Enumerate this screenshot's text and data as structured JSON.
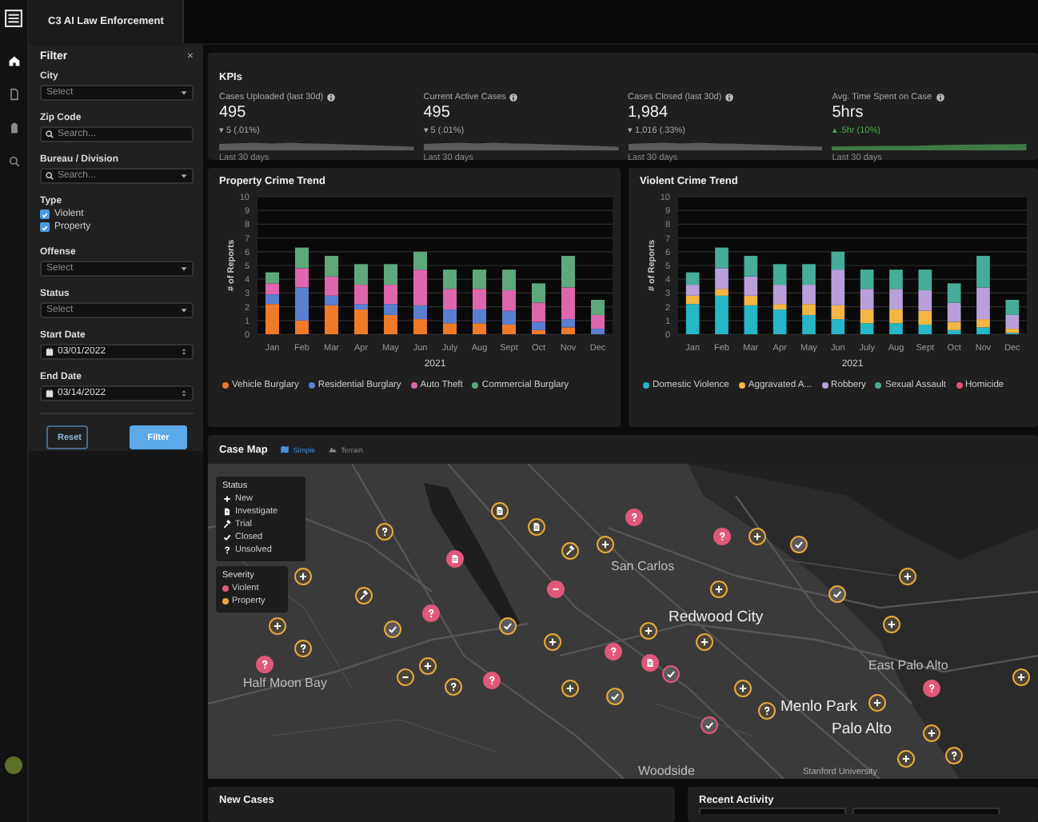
{
  "rail": [
    {
      "selected": true
    },
    {
      "selected": false
    },
    {
      "selected": false
    },
    {
      "selected": false
    }
  ],
  "app_tab": {
    "title": "C3 AI Law Enforcement"
  },
  "filter": {
    "title": "Filter",
    "close": "×",
    "fields": [
      {
        "kind": "select",
        "label": "City",
        "placeholder": "Select"
      },
      {
        "kind": "search",
        "label": "Zip Code",
        "placeholder": "Search..."
      },
      {
        "kind": "search_select",
        "label": "Bureau / Division",
        "placeholder": "Search..."
      },
      {
        "kind": "checkboxes",
        "label": "Type",
        "options": [
          {
            "label": "Violent",
            "checked": true
          },
          {
            "label": "Property",
            "checked": true
          }
        ]
      },
      {
        "kind": "select",
        "label": "Offense",
        "placeholder": "Select"
      },
      {
        "kind": "select",
        "label": "Status",
        "placeholder": "Select"
      },
      {
        "kind": "date",
        "label": "Start Date",
        "value": "03/01/2022"
      },
      {
        "kind": "date",
        "label": "End Date",
        "value": "03/14/2022"
      }
    ],
    "buttons": [
      {
        "label": "Reset",
        "kind": "secondary"
      },
      {
        "label": "Filter",
        "kind": "primary"
      }
    ]
  },
  "kpis": {
    "title": "KPIs",
    "items": [
      {
        "label": "Cases Uploaded (last 30d)",
        "value": "495",
        "change": "▾ 5 (.01%)",
        "positive": false,
        "footer": "Last 30 days"
      },
      {
        "label": "Current Active Cases",
        "value": "495",
        "change": "▾ 5 (.01%)",
        "positive": false,
        "footer": "Last 30 days"
      },
      {
        "label": "Cases Closed (last 30d)",
        "value": "1,984",
        "change": "▾ 1,016 (.33%)",
        "positive": false,
        "footer": "Last 30 days"
      },
      {
        "label": "Avg. Time Spent on Case",
        "value": "5hrs",
        "change": "▴ .5hr (10%)",
        "positive": true,
        "footer": "Last 30 days"
      }
    ]
  },
  "charts": [
    {
      "title": "Property Crime Trend",
      "chart_data": {
        "type": "bar",
        "stacked": true,
        "grid": true,
        "xlabel": "2021",
        "ylabel": "# of Reports",
        "categories": [
          "Jan",
          "Feb",
          "Mar",
          "Apr",
          "May",
          "Jun",
          "July",
          "Aug",
          "Sept",
          "Oct",
          "Nov",
          "Dec"
        ],
        "ylim": [
          0,
          10
        ],
        "yticks": [
          0,
          1,
          2,
          3,
          4,
          5,
          6,
          7,
          8,
          9,
          10
        ],
        "series": [
          {
            "name": "Vehicle Burglary",
            "color": "#f07a2a",
            "values": [
              2.2,
              1.0,
              2.1,
              1.8,
              1.4,
              1.1,
              0.8,
              0.8,
              0.7,
              0.3,
              0.5,
              0
            ]
          },
          {
            "name": "Residential Burglary",
            "color": "#5a7fd0",
            "values": [
              0.7,
              2.4,
              0.7,
              0.4,
              0.8,
              1.0,
              1.0,
              1.0,
              1.0,
              0.6,
              0.6,
              0.4
            ]
          },
          {
            "name": "Auto Theft",
            "color": "#de66ad",
            "values": [
              0.8,
              1.4,
              1.4,
              1.4,
              1.4,
              2.6,
              1.5,
              1.5,
              1.5,
              1.4,
              2.3,
              1.0
            ]
          },
          {
            "name": "Commercial Burglary",
            "color": "#5fa87e",
            "values": [
              0.8,
              1.5,
              1.5,
              1.5,
              1.5,
              1.3,
              1.4,
              1.4,
              1.5,
              1.4,
              2.3,
              1.1
            ]
          }
        ]
      }
    },
    {
      "title": "Violent Crime Trend",
      "chart_data": {
        "type": "bar",
        "stacked": true,
        "grid": true,
        "xlabel": "2021",
        "ylabel": "# of Reports",
        "categories": [
          "Jan",
          "Feb",
          "Mar",
          "Apr",
          "May",
          "Jun",
          "July",
          "Aug",
          "Sept",
          "Oct",
          "Nov",
          "Dec"
        ],
        "ylim": [
          0,
          10
        ],
        "yticks": [
          0,
          1,
          2,
          3,
          4,
          5,
          6,
          7,
          8,
          9,
          10
        ],
        "series": [
          {
            "name": "Domestic Violence",
            "color": "#27b6c6",
            "values": [
              2.2,
              2.8,
              2.1,
              1.8,
              1.4,
              1.1,
              0.8,
              0.8,
              0.7,
              0.3,
              0.5,
              0.1
            ]
          },
          {
            "name": "Aggravated A...",
            "color": "#f2b645",
            "values": [
              0.6,
              0.5,
              0.7,
              0.4,
              0.8,
              1.0,
              1.0,
              1.0,
              1.0,
              0.6,
              0.6,
              0.3
            ]
          },
          {
            "name": "Robbery",
            "color": "#b9a0da",
            "values": [
              0.8,
              1.5,
              1.4,
              1.4,
              1.4,
              2.6,
              1.5,
              1.5,
              1.5,
              1.4,
              2.3,
              1.0
            ]
          },
          {
            "name": "Sexual Assault",
            "color": "#45ad98",
            "values": [
              0.9,
              1.5,
              1.5,
              1.5,
              1.5,
              1.3,
              1.4,
              1.4,
              1.5,
              1.4,
              2.3,
              1.1
            ]
          },
          {
            "name": "Homicide",
            "color": "#e4506e",
            "values": [
              0,
              0,
              0,
              0,
              0,
              0,
              0,
              0,
              0,
              0,
              0,
              0
            ]
          }
        ]
      }
    }
  ],
  "case_map": {
    "title": "Case Map",
    "views": [
      {
        "label": "Simple",
        "selected": true
      },
      {
        "label": "Terrain",
        "selected": false
      }
    ],
    "status_legend": {
      "title": "Status",
      "items": [
        {
          "kind": "new",
          "label": "New"
        },
        {
          "kind": "investigate",
          "label": "Investigate"
        },
        {
          "kind": "trial",
          "label": "Trial"
        },
        {
          "kind": "closed",
          "label": "Closed"
        },
        {
          "kind": "unsolved",
          "label": "Unsolved"
        }
      ]
    },
    "severity_legend": {
      "title": "Severity",
      "items": [
        {
          "label": "Violent",
          "color": "#e0587a"
        },
        {
          "label": "Property",
          "color": "#e5a93c"
        }
      ]
    },
    "places": [
      {
        "name": "Half Moon Bay",
        "kind": "town"
      },
      {
        "name": "San Carlos",
        "kind": "town"
      },
      {
        "name": "Redwood City",
        "kind": "city"
      },
      {
        "name": "East Palo Alto",
        "kind": "town"
      },
      {
        "name": "Menlo Park",
        "kind": "city"
      },
      {
        "name": "Palo Alto",
        "kind": "city"
      },
      {
        "name": "Woodside",
        "kind": "town"
      },
      {
        "name": "Stanford University",
        "kind": "landmark"
      }
    ],
    "pins": [
      {
        "kind": "unsolved",
        "violent": false
      },
      {
        "kind": "investigate",
        "violent": false
      },
      {
        "kind": "investigate",
        "violent": false
      },
      {
        "kind": "trial",
        "violent": false
      },
      {
        "kind": "investigate",
        "violent": true
      },
      {
        "kind": "unsolved",
        "violent": true
      },
      {
        "kind": "unsolved",
        "violent": true
      },
      {
        "kind": "new",
        "violent": false
      },
      {
        "kind": "closed",
        "violent": false
      },
      {
        "kind": "new",
        "violent": false
      },
      {
        "kind": "trial",
        "violent": false
      },
      {
        "kind": "minus",
        "violent": true
      },
      {
        "kind": "new",
        "violent": false
      },
      {
        "kind": "new",
        "violent": false
      },
      {
        "kind": "closed",
        "violent": false
      },
      {
        "kind": "new",
        "violent": false
      },
      {
        "kind": "new",
        "violent": false
      },
      {
        "kind": "unsolved",
        "violent": true
      },
      {
        "kind": "closed",
        "violent": false
      },
      {
        "kind": "closed",
        "violent": false
      },
      {
        "kind": "unsolved",
        "violent": false
      },
      {
        "kind": "new",
        "violent": false
      },
      {
        "kind": "new",
        "violent": false
      },
      {
        "kind": "new",
        "violent": false
      },
      {
        "kind": "new",
        "violent": false
      },
      {
        "kind": "unsolved",
        "violent": true
      },
      {
        "kind": "new",
        "violent": false
      },
      {
        "kind": "minus",
        "violent": false
      },
      {
        "kind": "unsolved",
        "violent": false
      },
      {
        "kind": "unsolved",
        "violent": true
      },
      {
        "kind": "new",
        "violent": false
      },
      {
        "kind": "closed",
        "violent": false
      },
      {
        "kind": "unsolved",
        "violent": true
      },
      {
        "kind": "investigate",
        "violent": true
      },
      {
        "kind": "closed",
        "violent": true
      },
      {
        "kind": "new",
        "violent": false
      },
      {
        "kind": "unsolved",
        "violent": false
      },
      {
        "kind": "closed",
        "violent": true
      },
      {
        "kind": "new",
        "violent": false
      },
      {
        "kind": "new",
        "violent": false
      },
      {
        "kind": "new",
        "violent": false
      },
      {
        "kind": "unsolved",
        "violent": false
      },
      {
        "kind": "unsolved",
        "violent": true
      },
      {
        "kind": "new",
        "violent": false
      }
    ]
  },
  "new_cases": {
    "title": "New Cases"
  },
  "recent_activity": {
    "title": "Recent Activity"
  }
}
